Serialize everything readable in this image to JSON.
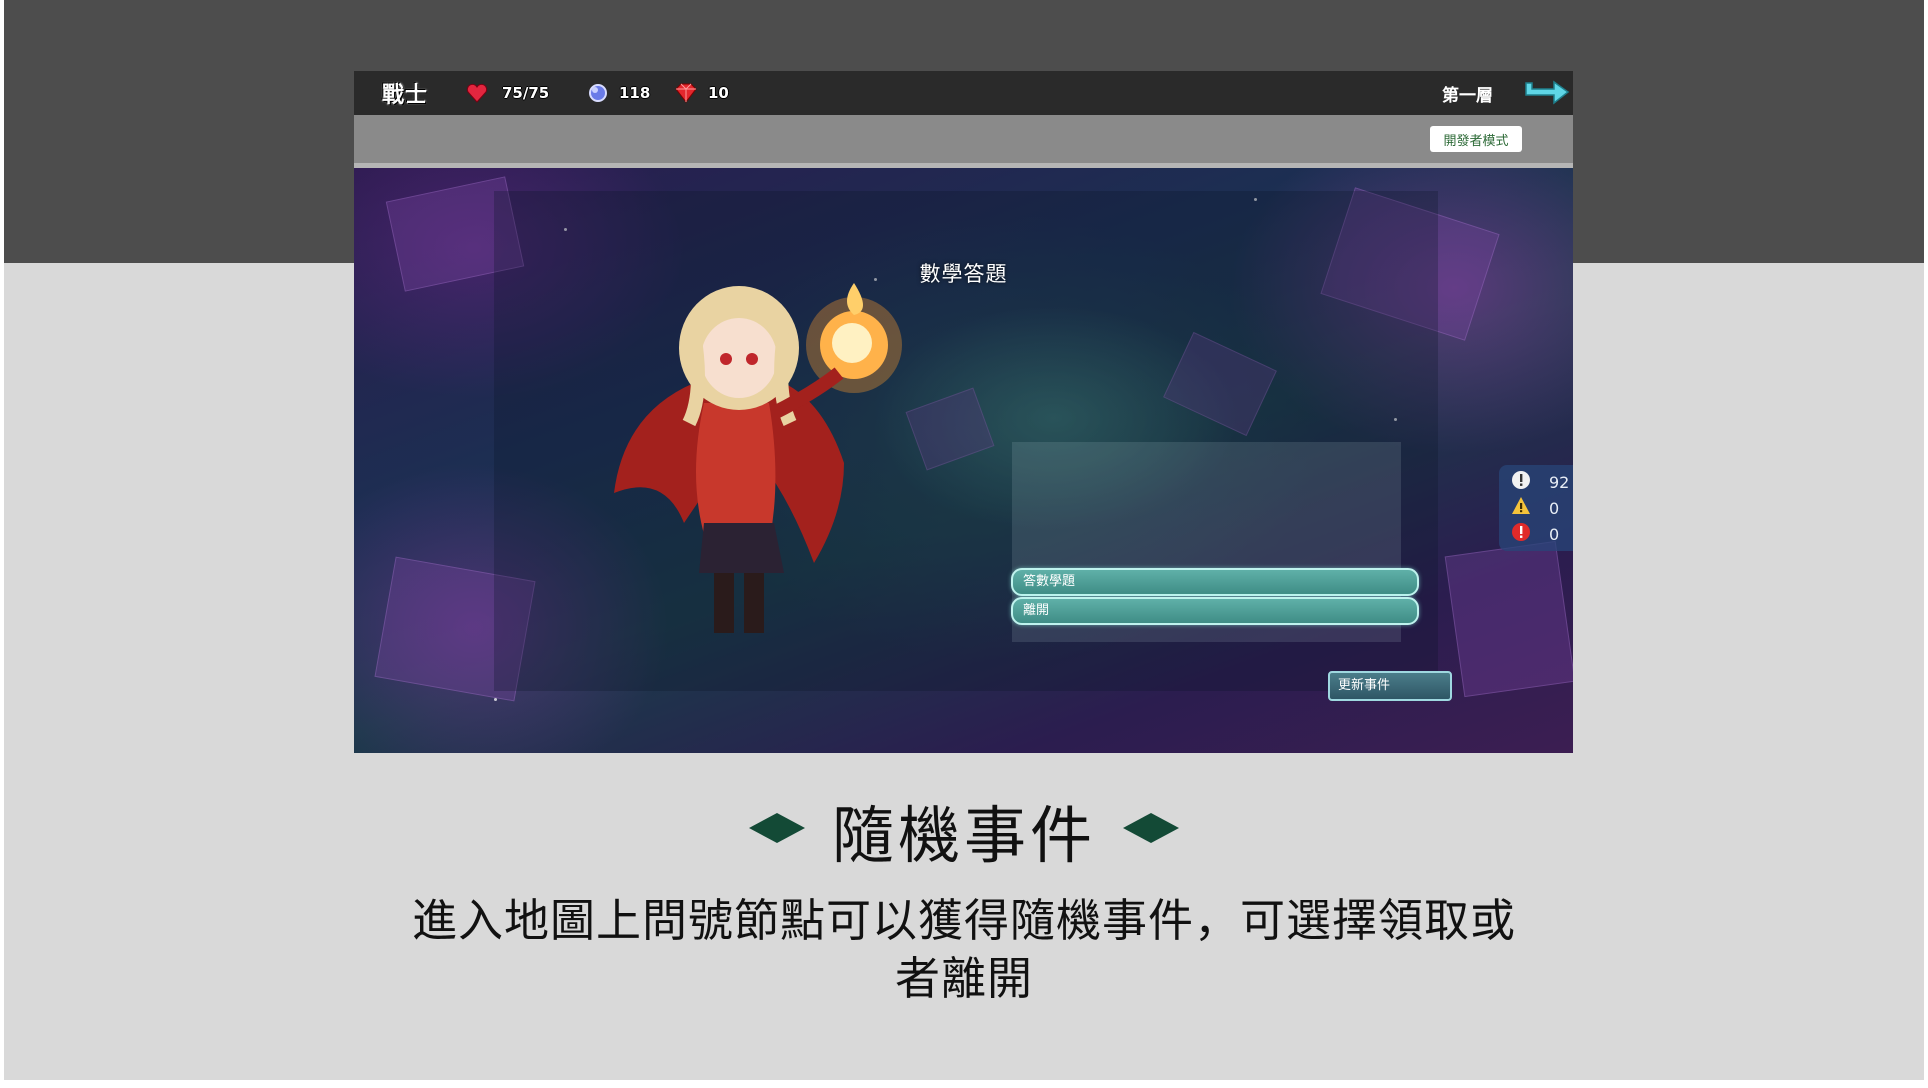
{
  "hud": {
    "class_name": "戰士",
    "hp": "75/75",
    "mana": "118",
    "gems": "10",
    "floor": "第一層",
    "icons": [
      "heart-icon",
      "mana-orb-icon",
      "ruby-icon",
      "next-arrow-icon"
    ]
  },
  "dev_mode_button": "開發者模式",
  "event": {
    "title": "數學答題",
    "options": [
      "答數學題",
      "離開"
    ],
    "refresh_label": "更新事件"
  },
  "log_counts": {
    "info": "92",
    "warning": "0",
    "error": "0"
  },
  "caption": {
    "title": "隨機事件",
    "line1": "進入地圖上問號節點可以獲得隨機事件，可選擇領取或",
    "line2": "者離開"
  },
  "colors": {
    "band": "#4d4d4d",
    "slide_bg": "#d9d9d9",
    "accent_diamond": "#134a36",
    "option_teal": "#4fa09a"
  }
}
